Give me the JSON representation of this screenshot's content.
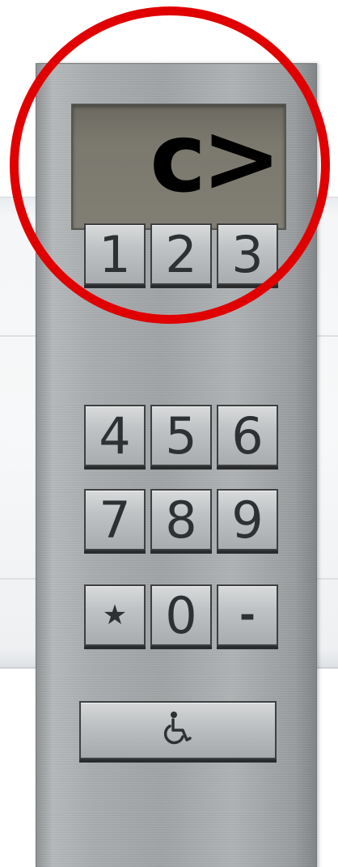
{
  "colors": {
    "highlight_ring": "#e00000",
    "panel": "#a8abad",
    "display": "#7b796e",
    "key": "#bfc2c4",
    "text": "#2e3133"
  },
  "display": {
    "text": "c>"
  },
  "keypad": {
    "rows": [
      [
        "1",
        "2",
        "3"
      ],
      [
        "4",
        "5",
        "6"
      ],
      [
        "7",
        "8",
        "9"
      ],
      [
        "★",
        "0",
        "-"
      ]
    ],
    "accessibility_icon": "wheelchair-icon"
  }
}
